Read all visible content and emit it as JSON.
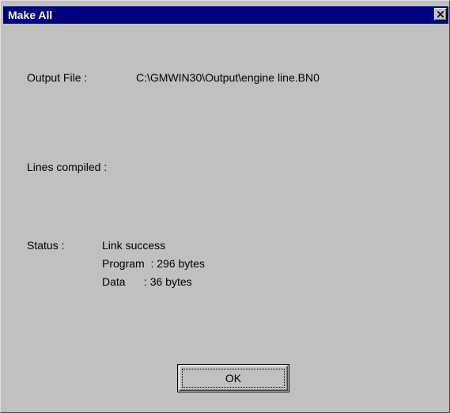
{
  "window": {
    "title": "Make All",
    "close_icon": "close-x-icon"
  },
  "output_file": {
    "label": "Output File :",
    "value": "C:\\GMWIN30\\Output\\engine line.BN0"
  },
  "lines_compiled": {
    "label": "Lines compiled :",
    "value": ""
  },
  "status": {
    "label": "Status :",
    "lines": [
      "Link success",
      "Program  : 296 bytes",
      "Data      : 36 bytes"
    ]
  },
  "buttons": {
    "ok_label": "OK"
  },
  "colors": {
    "title_bar": "#000080",
    "dialog_face": "#c0c0c0",
    "title_text": "#ffffff"
  }
}
